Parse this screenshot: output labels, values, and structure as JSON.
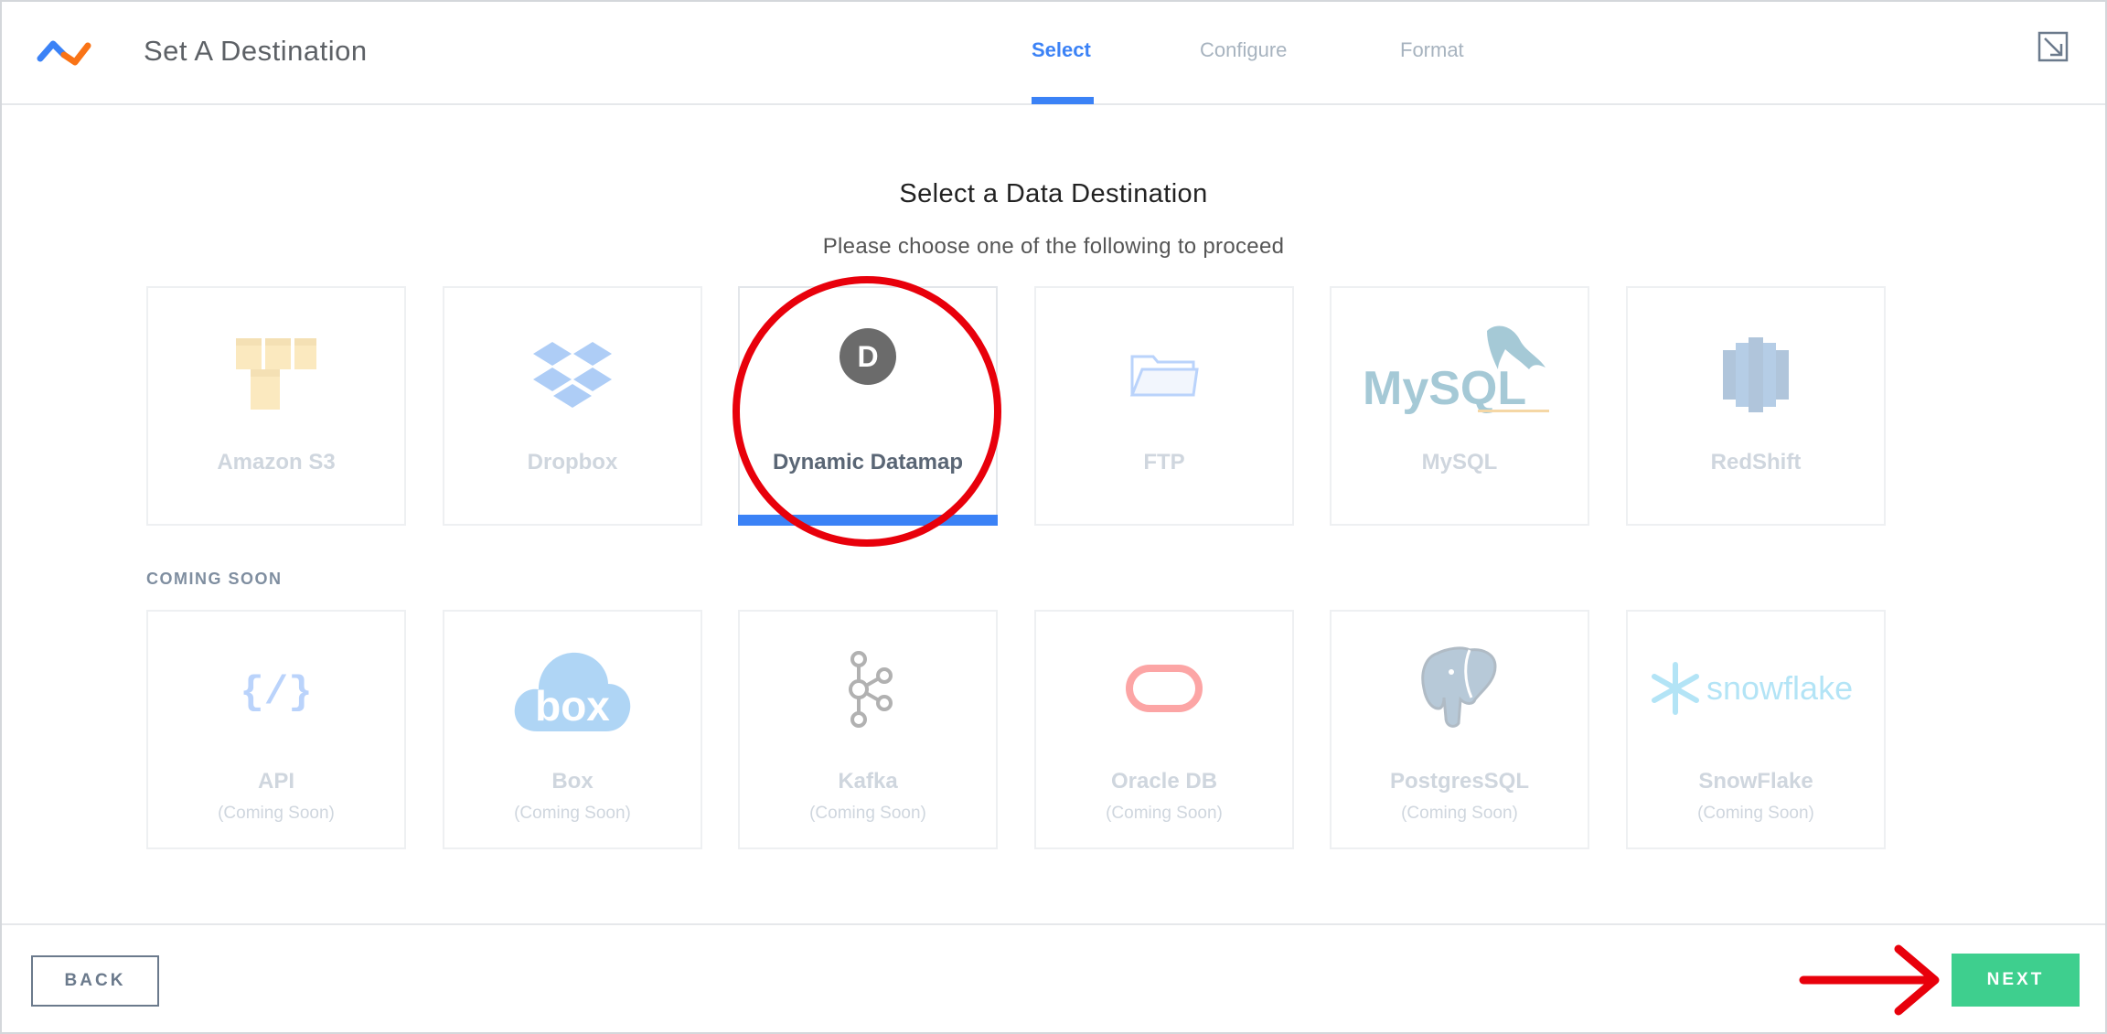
{
  "header": {
    "title": "Set A Destination",
    "tabs": [
      {
        "label": "Select",
        "active": true
      },
      {
        "label": "Configure",
        "active": false
      },
      {
        "label": "Format",
        "active": false
      }
    ]
  },
  "main": {
    "heading": "Select a Data Destination",
    "subheading": "Please choose one of the following to proceed",
    "destinations": [
      {
        "label": "Amazon S3",
        "icon": "amazon-s3-icon"
      },
      {
        "label": "Dropbox",
        "icon": "dropbox-icon"
      },
      {
        "label": "Dynamic Datamap",
        "icon": "d-circle-icon",
        "icon_letter": "D",
        "selected": true
      },
      {
        "label": "FTP",
        "icon": "folder-icon"
      },
      {
        "label": "MySQL",
        "icon": "mysql-logo",
        "logo_text": "MySQL"
      },
      {
        "label": "RedShift",
        "icon": "redshift-icon"
      }
    ],
    "coming_soon_title": "COMING SOON",
    "coming_soon": [
      {
        "label": "API",
        "sub": "(Coming Soon)",
        "icon": "api-braces-icon",
        "icon_text": "{/}"
      },
      {
        "label": "Box",
        "sub": "(Coming Soon)",
        "icon": "box-cloud-icon",
        "logo_text": "box"
      },
      {
        "label": "Kafka",
        "sub": "(Coming Soon)",
        "icon": "kafka-icon"
      },
      {
        "label": "Oracle DB",
        "sub": "(Coming Soon)",
        "icon": "oracle-icon"
      },
      {
        "label": "PostgresSQL",
        "sub": "(Coming Soon)",
        "icon": "postgres-elephant-icon"
      },
      {
        "label": "SnowFlake",
        "sub": "(Coming Soon)",
        "icon": "snowflake-icon",
        "logo_text": "snowflake"
      }
    ]
  },
  "footer": {
    "back_label": "BACK",
    "next_label": "NEXT"
  },
  "colors": {
    "accent": "#3b82f6",
    "next": "#3ecf8e",
    "annotation": "#e8000b"
  }
}
